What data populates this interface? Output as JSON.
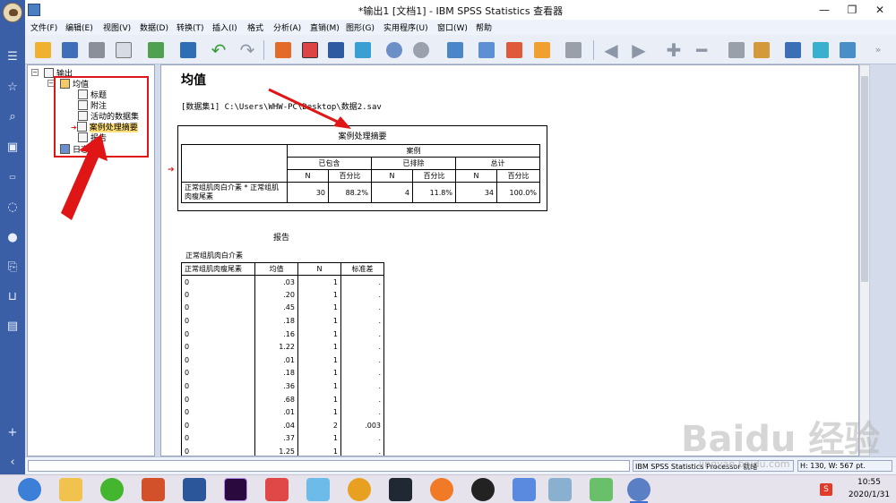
{
  "window": {
    "title": "*输出1 [文档1] - IBM SPSS Statistics 查看器",
    "minimize": "—",
    "maximize": "❐",
    "close": "✕"
  },
  "menu": [
    {
      "label": "文件(F)"
    },
    {
      "label": "编辑(E)"
    },
    {
      "label": "视图(V)"
    },
    {
      "label": "数据(D)"
    },
    {
      "label": "转换(T)"
    },
    {
      "label": "插入(I)"
    },
    {
      "label": "格式"
    },
    {
      "label": "分析(A)"
    },
    {
      "label": "直销(M)"
    },
    {
      "label": "图形(G)"
    },
    {
      "label": "实用程序(U)"
    },
    {
      "label": "窗口(W)"
    },
    {
      "label": "帮助"
    }
  ],
  "outline": {
    "root": "输出",
    "node": "均值",
    "items": [
      "标题",
      "附注",
      "活动的数据集",
      "案例处理摘要",
      "报告"
    ],
    "selected": "案例处理摘要",
    "log": "日志"
  },
  "content": {
    "heading": "均值",
    "file_path": "[数据集1] C:\\Users\\WHW-PC\\Desktop\\数据2.sav",
    "case_summary": {
      "title": "案例处理摘要",
      "group_header": "案例",
      "sub_headers": [
        "已包含",
        "已排除",
        "总计"
      ],
      "col_headers": [
        "N",
        "百分比",
        "N",
        "百分比",
        "N",
        "百分比"
      ],
      "row_label": "正常组肌肉白介素 * 正常组肌肉瘦尾素",
      "values": [
        "30",
        "88.2%",
        "4",
        "11.8%",
        "34",
        "100.0%"
      ]
    },
    "report": {
      "title": "报告",
      "dependent": "正常组肌肉白介素",
      "headers": [
        "正常组肌肉瘦尾素",
        "均值",
        "N",
        "标准差"
      ],
      "rows": [
        [
          "0",
          ".03",
          "1",
          "."
        ],
        [
          "0",
          ".20",
          "1",
          "."
        ],
        [
          "0",
          ".45",
          "1",
          "."
        ],
        [
          "0",
          ".18",
          "1",
          "."
        ],
        [
          "0",
          ".16",
          "1",
          "."
        ],
        [
          "0",
          "1.22",
          "1",
          "."
        ],
        [
          "0",
          ".01",
          "1",
          "."
        ],
        [
          "0",
          ".18",
          "1",
          "."
        ],
        [
          "0",
          ".36",
          "1",
          "."
        ],
        [
          "0",
          ".68",
          "1",
          "."
        ],
        [
          "0",
          ".01",
          "1",
          "."
        ],
        [
          "0",
          ".04",
          "2",
          ".003"
        ],
        [
          "0",
          ".37",
          "1",
          "."
        ],
        [
          "0",
          "1.25",
          "1",
          "."
        ]
      ]
    }
  },
  "status": {
    "processor": "IBM SPSS Statistics Processor 就绪",
    "dims": "H: 130, W: 567 pt."
  },
  "taskbar": {
    "time": "10:55",
    "date": "2020/1/31",
    "tray_badge": "S"
  },
  "watermark": {
    "text": "Baidu 经验",
    "sub": "jingyan.baidu.com"
  },
  "colors": {
    "highlight": "#e01515",
    "selection": "#ffe07a",
    "sidebar": "#3b5fa7"
  }
}
